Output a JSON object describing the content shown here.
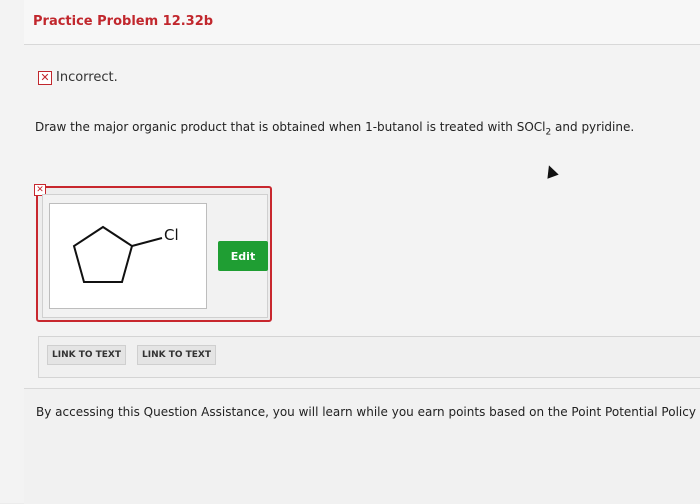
{
  "problem": {
    "title": "Practice Problem 12.32b",
    "status_label": "Incorrect.",
    "question_pre": "Draw the major organic product that is obtained when 1-butanol is treated with SOCl",
    "question_sub": "2",
    "question_post": " and pyridine."
  },
  "answer": {
    "substituent_label": "Cl",
    "edit_button": "Edit"
  },
  "links": {
    "link1": "LINK TO TEXT",
    "link2": "LINK TO TEXT"
  },
  "assistance": {
    "text": "By accessing this Question Assistance, you will learn while you earn points based on the Point Potential Policy"
  },
  "icons": {
    "incorrect": "close-icon",
    "cursor": "mouse-pointer-icon"
  },
  "colors": {
    "title_red": "#c1272d",
    "edit_green": "#1f9e33",
    "frame_red": "#c8272e"
  }
}
